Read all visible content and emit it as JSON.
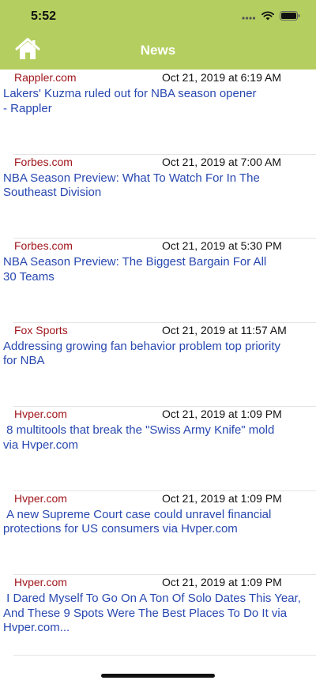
{
  "status_bar": {
    "time": "5:52",
    "icons": [
      "signal-dots-icon",
      "wifi-icon",
      "battery-icon"
    ]
  },
  "nav": {
    "title": "News",
    "home_icon": "home-icon"
  },
  "colors": {
    "header_bg": "#b4cf5f",
    "source_text": "#a0161c",
    "headline_text": "#2848b0"
  },
  "articles": [
    {
      "source": "Rappler.com",
      "date": "Oct 21, 2019 at 6:19 AM",
      "headline": "Lakers' Kuzma ruled out for NBA season opener\n- Rappler"
    },
    {
      "source": "Forbes.com",
      "date": "Oct 21, 2019 at 7:00 AM",
      "headline": "NBA Season Preview: What To Watch For In The\nSoutheast Division"
    },
    {
      "source": "Forbes.com",
      "date": "Oct 21, 2019 at 5:30 PM",
      "headline": "NBA Season Preview: The Biggest Bargain For All\n30 Teams"
    },
    {
      "source": "Fox Sports",
      "date": "Oct 21, 2019 at 11:57 AM",
      "headline": "Addressing growing fan behavior problem top priority\nfor NBA"
    },
    {
      "source": "Hvper.com",
      "date": "Oct 21, 2019 at 1:09 PM",
      "headline": " 8 multitools that break the \"Swiss Army Knife\" mold\nvia Hvper.com"
    },
    {
      "source": "Hvper.com",
      "date": "Oct 21, 2019 at 1:09 PM",
      "headline": " A new Supreme Court case could unravel financial\nprotections for US consumers via Hvper.com"
    },
    {
      "source": "Hvper.com",
      "date": "Oct 21, 2019 at 1:09 PM",
      "headline": " I Dared Myself To Go On A Ton Of Solo Dates This Year,\nAnd These 9 Spots Were The Best Places To Do It via\nHvper.com..."
    }
  ]
}
